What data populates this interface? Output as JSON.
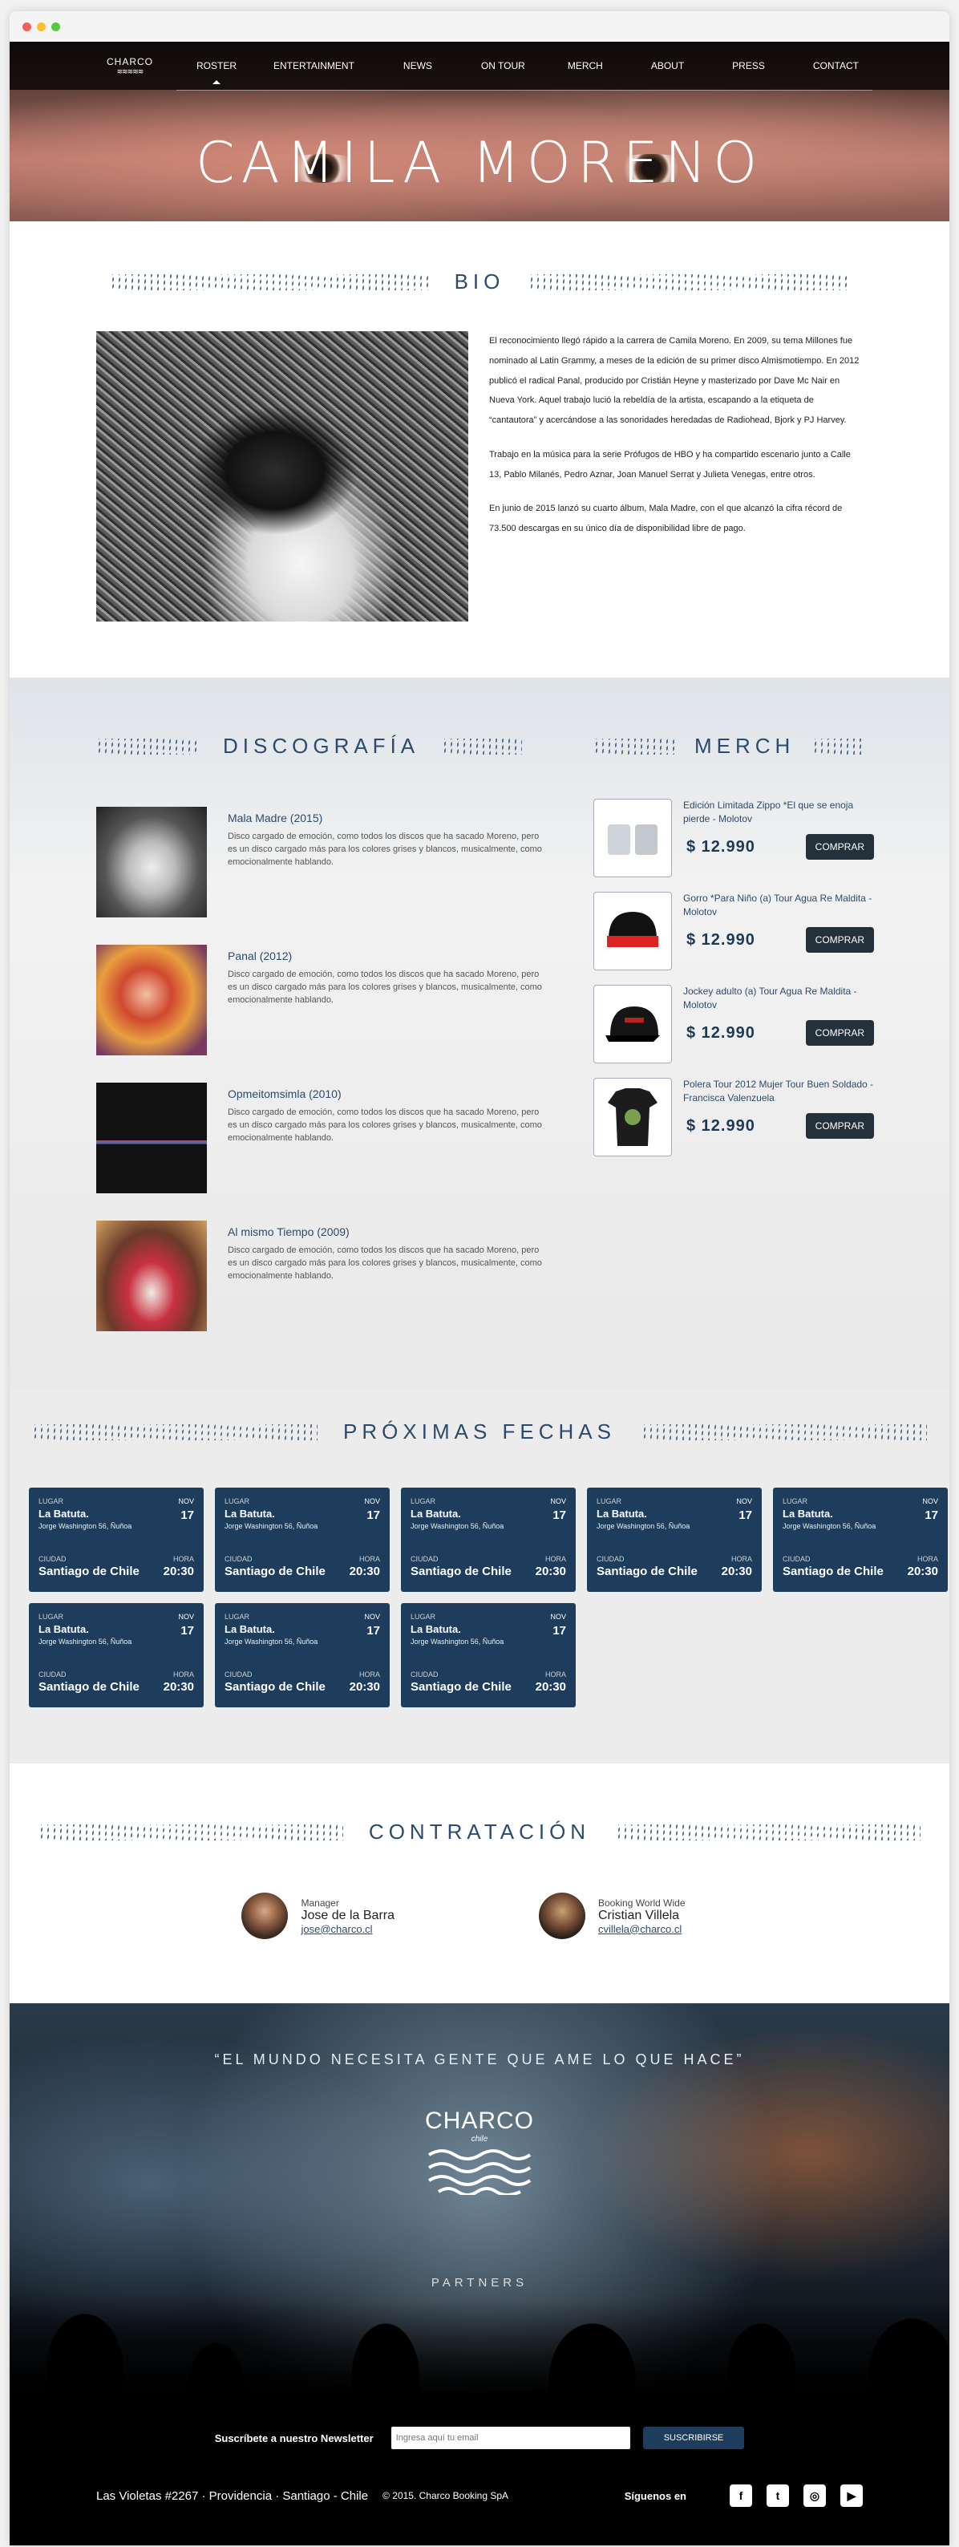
{
  "nav": {
    "logo": "CHARCO",
    "items": [
      "ROSTER",
      "ENTERTAINMENT",
      "NEWS",
      "ON TOUR",
      "MERCH",
      "ABOUT",
      "PRESS",
      "CONTACT"
    ]
  },
  "hero": {
    "title": "Camila Moreno"
  },
  "bio": {
    "title": "BIO",
    "paragraphs": [
      "El reconocimiento llegó rápido a la carrera de Camila Moreno. En 2009, su tema Millones fue nominado al Latin Grammy, a meses de la edición de su primer disco Almismotiempo. En 2012 publicó el radical Panal, producido por Cristián Heyne y masterizado por Dave Mc Nair en Nueva York. Aquel trabajo lució la rebeldía de la artista, escapando a la etiqueta de “cantautora” y acercándose a las sonoridades heredadas de Radiohead, Bjork y PJ Harvey.",
      "Trabajo en la música para la serie Prófugos de HBO y ha compartido escenario junto a Calle 13, Pablo Milanés, Pedro Aznar, Joan Manuel Serrat y Julieta Venegas, entre otros.",
      "En junio de 2015 lanzó su cuarto álbum, Mala Madre, con el que alcanzó la cifra récord de 73.500 descargas en su único día de disponibilidad libre de pago."
    ]
  },
  "disco": {
    "title": "DISCOGRAFÍA",
    "albums": [
      {
        "title": "Mala Madre (2015)",
        "desc": "Disco cargado de emoción, como todos los discos que ha sacado Moreno, pero es un disco cargado más para los colores grises y blancos, musicalmente, como emocionalmente hablando."
      },
      {
        "title": "Panal (2012)",
        "desc": "Disco cargado de emoción, como todos los discos que ha sacado Moreno, pero es un disco cargado más para los colores grises y blancos, musicalmente, como emocionalmente hablando."
      },
      {
        "title": "Opmeitomsimla (2010)",
        "desc": "Disco cargado de emoción, como todos los discos que ha sacado Moreno, pero es un disco cargado más para los colores grises y blancos, musicalmente, como emocionalmente hablando."
      },
      {
        "title": "Al mismo Tiempo (2009)",
        "desc": "Disco cargado de emoción, como todos los discos que ha sacado Moreno, pero es un disco cargado más para los colores grises y blancos, musicalmente, como emocionalmente hablando."
      }
    ]
  },
  "merch": {
    "title": "MERCH",
    "buy_label": "COMPRAR",
    "items": [
      {
        "name": "Edición Limitada Zippo *El que se enoja pierde - Molotov",
        "price": "$ 12.990"
      },
      {
        "name": "Gorro *Para Niño (a) Tour Agua Re Maldita - Molotov",
        "price": "$ 12.990"
      },
      {
        "name": "Jockey adulto (a) Tour Agua Re Maldita - Molotov",
        "price": "$ 12.990"
      },
      {
        "name": "Polera Tour 2012 Mujer Tour Buen Soldado - Francisca Valenzuela",
        "price": "$ 12.990"
      }
    ]
  },
  "dates": {
    "title": "PRÓXIMAS FECHAS",
    "labels": {
      "place": "LUGAR",
      "city": "CIUDAD",
      "hour": "HORA"
    },
    "card": {
      "venue": "La Batuta.",
      "address": "Jorge Washington 56, Ñuñoa",
      "month": "NOV",
      "day": "17",
      "city": "Santiago de Chile",
      "time": "20:30"
    }
  },
  "contract": {
    "title": "CONTRATACIÓN",
    "contacts": [
      {
        "role": "Manager",
        "name": "Jose de la Barra",
        "email": "jose@charco.cl"
      },
      {
        "role": "Booking World Wide",
        "name": "Cristian Villela",
        "email": "cvillela@charco.cl"
      }
    ]
  },
  "footer": {
    "quote": "“El mundo necesita gente que ame lo que hace”",
    "logo": "CHARCO",
    "logo_sub": "chile",
    "partners": "PARTNERS",
    "newsletter_label": "Suscríbete a nuestro Newsletter",
    "newsletter_placeholder": "Ingresa aquí tu email",
    "subscribe": "SUSCRIBIRSE",
    "address": "Las Violetas #2267  ·  Providencia  ·  Santiago - Chile",
    "copyright": "© 2015. Charco Booking SpA",
    "follow": "Síguenos en",
    "socials": [
      "facebook-icon",
      "twitter-icon",
      "instagram-icon",
      "youtube-icon"
    ]
  },
  "colors": {
    "accent": "#2c4a6e",
    "card": "#1e3d5c",
    "button": "#25303d"
  }
}
